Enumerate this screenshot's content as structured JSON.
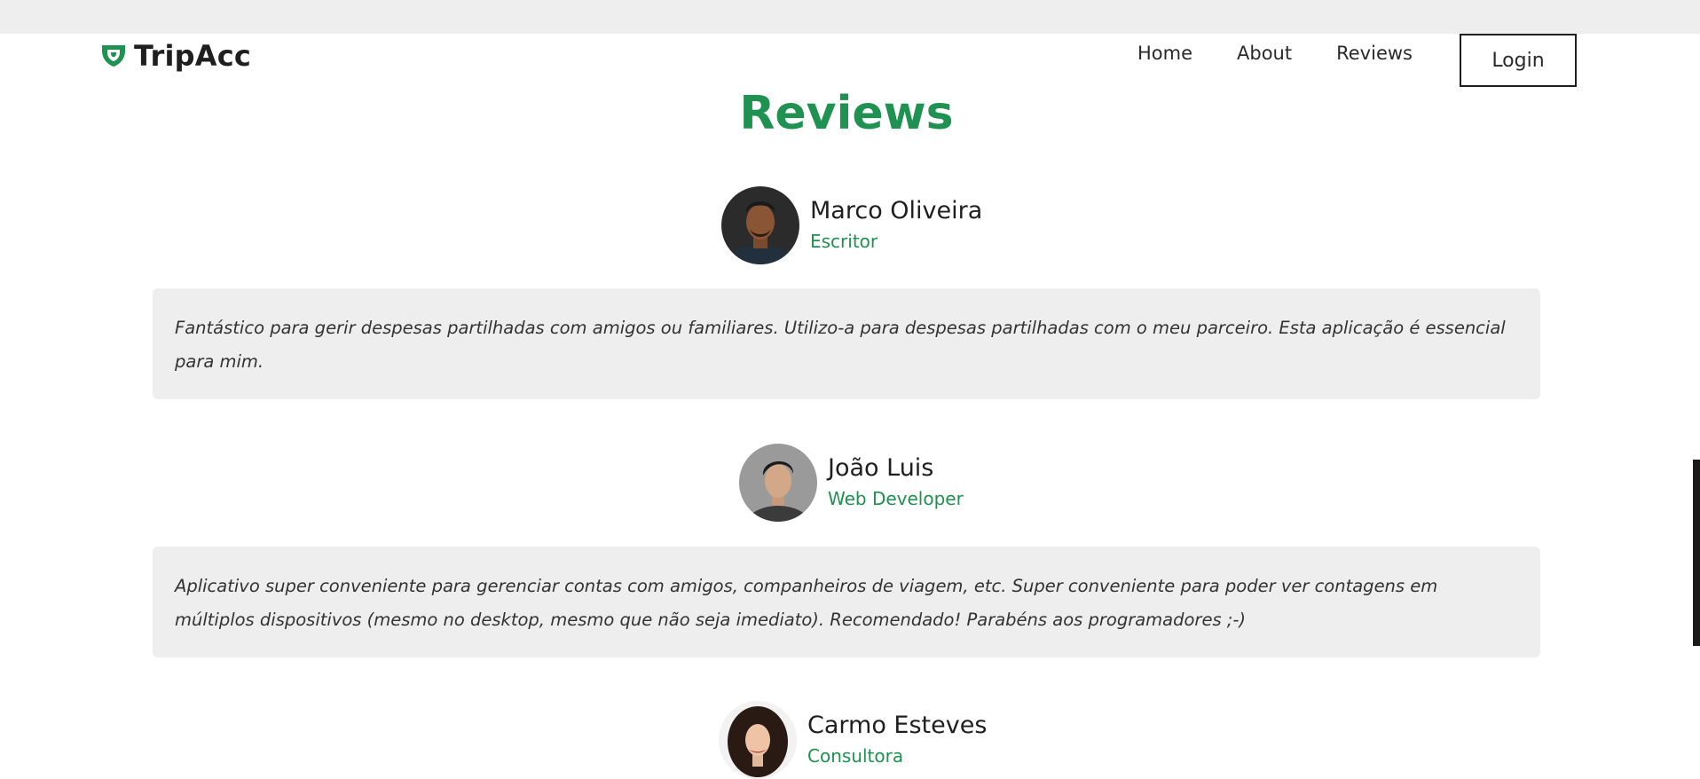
{
  "brand": {
    "name": "TripAcc",
    "logo_icon": "shield-logo-icon",
    "accent": "#1f9150"
  },
  "nav": {
    "items": [
      "Home",
      "About",
      "Reviews"
    ],
    "login_label": "Login"
  },
  "page": {
    "title": "Reviews"
  },
  "reviews": [
    {
      "name": "Marco Oliveira",
      "role": "Escritor",
      "text": "Fantástico para gerir despesas partilhadas com amigos ou familiares. Utilizo-a para despesas partilhadas com o meu parceiro. Esta aplicação é essencial para mim."
    },
    {
      "name": "João Luis",
      "role": "Web Developer",
      "text": "Aplicativo super conveniente para gerenciar contas com amigos, companheiros de viagem, etc. Super conveniente para poder ver contagens em múltiplos dispositivos (mesmo no desktop, mesmo que não seja imediato). Recomendado! Parabéns aos programadores ;-)"
    },
    {
      "name": "Carmo Esteves",
      "role": "Consultora",
      "text": ""
    }
  ]
}
